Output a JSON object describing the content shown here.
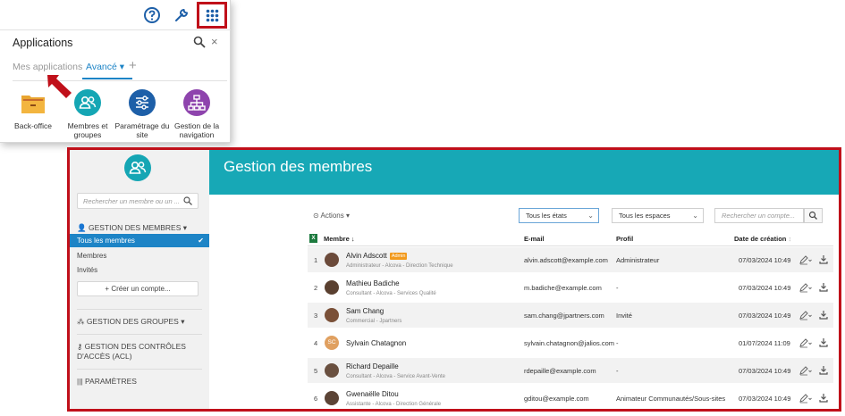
{
  "apps_panel": {
    "title": "Applications",
    "tabs": [
      "Mes applications",
      "Avancé"
    ],
    "add_tab": "+",
    "close": "×",
    "apps": [
      {
        "label_1": "Back-office",
        "label_2": "",
        "color": "#f3b53f",
        "icon": "folder-icon"
      },
      {
        "label_1": "Membres et",
        "label_2": "groupes",
        "color": "#15a6b4",
        "icon": "users-icon"
      },
      {
        "label_1": "Paramétrage du",
        "label_2": "site",
        "color": "#1d5fa8",
        "icon": "sliders-icon"
      },
      {
        "label_1": "Gestion de la",
        "label_2": "navigation",
        "color": "#8e44ad",
        "icon": "sitemap-icon"
      }
    ]
  },
  "sidebar": {
    "search_placeholder": "Rechercher un membre ou un ...",
    "members_head": "GESTION DES MEMBRES",
    "items": [
      "Tous les membres",
      "Membres",
      "Invités"
    ],
    "create_button": "Créer un compte...",
    "groups_head": "GESTION DES GROUPES",
    "acl_head": "GESTION DES CONTRÔLES D'ACCÈS (ACL)",
    "params_head": "PARAMÈTRES"
  },
  "header": {
    "title": "Gestion des membres",
    "color": "#17a8b6"
  },
  "toolbar": {
    "actions": "Actions",
    "filter_state": "Tous les états",
    "filter_spaces": "Tous les espaces",
    "search_placeholder": "Rechercher un compte..."
  },
  "table": {
    "columns": [
      "Membre",
      "E-mail",
      "Profil",
      "Date de création"
    ],
    "rows": [
      {
        "num": "1",
        "name": "Alvin Adscott",
        "badge": "Admin",
        "sub": "Administrateur - Alcova - Direction Technique",
        "email": "alvin.adscott@example.com",
        "profil": "Administrateur",
        "date": "07/03/2024 10:49"
      },
      {
        "num": "2",
        "name": "Mathieu Badiche",
        "badge": "",
        "sub": "Consultant - Alcova - Services Qualité",
        "email": "m.badiche@example.com",
        "profil": "-",
        "date": "07/03/2024 10:49"
      },
      {
        "num": "3",
        "name": "Sam Chang",
        "badge": "",
        "sub": "Commercial - Jpartners",
        "email": "sam.chang@jpartners.com",
        "profil": "Invité",
        "date": "07/03/2024 10:49"
      },
      {
        "num": "4",
        "name": "Sylvain Chatagnon",
        "badge": "",
        "sub": "",
        "initials": "SC",
        "email": "sylvain.chatagnon@jalios.com",
        "profil": "-",
        "date": "01/07/2024 11:09"
      },
      {
        "num": "5",
        "name": "Richard Depaille",
        "badge": "",
        "sub": "Consultant - Alcova - Service Avant-Vente",
        "email": "rdepaille@example.com",
        "profil": "-",
        "date": "07/03/2024 10:49"
      },
      {
        "num": "6",
        "name": "Gwenaëlle Ditou",
        "badge": "",
        "sub": "Assistante - Alcova - Direction Générale",
        "email": "gditou@example.com",
        "profil": "Animateur Communautés/Sous-sites",
        "date": "07/03/2024 10:49"
      }
    ]
  },
  "colors": {
    "accent": "#1d84c6",
    "highlight_red": "#c0101a",
    "badge": "#f29a1d"
  }
}
